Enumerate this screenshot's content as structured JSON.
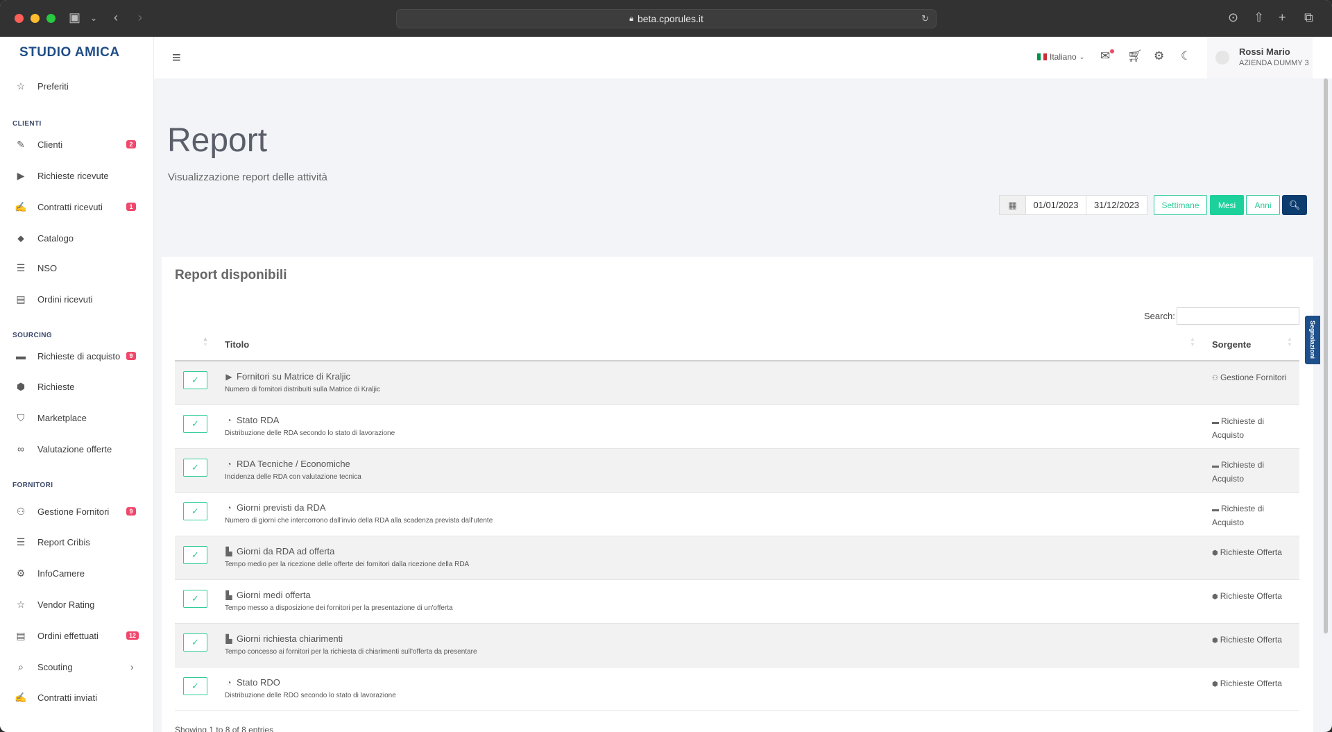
{
  "browser": {
    "url": "beta.cporules.it"
  },
  "sidebar": {
    "brand": "STUDIO AMICA",
    "items": [
      {
        "label": "Preferiti",
        "icon": "star-icon"
      },
      {
        "section": "CLIENTI"
      },
      {
        "label": "Clienti",
        "icon": "handshake-icon",
        "badge": "2"
      },
      {
        "label": "Richieste ricevute",
        "icon": "play-circle-icon"
      },
      {
        "label": "Contratti ricevuti",
        "icon": "contract-icon",
        "badge": "1"
      },
      {
        "label": "Catalogo",
        "icon": "tags-icon"
      },
      {
        "label": "NSO",
        "icon": "list-icon"
      },
      {
        "label": "Ordini ricevuti",
        "icon": "receipt-icon"
      },
      {
        "section": "SOURCING"
      },
      {
        "label": "Richieste di acquisto",
        "icon": "card-icon",
        "badge": "9"
      },
      {
        "label": "Richieste",
        "icon": "cube-icon"
      },
      {
        "label": "Marketplace",
        "icon": "shopping-bag-icon"
      },
      {
        "label": "Valutazione offerte",
        "icon": "glasses-icon"
      },
      {
        "section": "FORNITORI"
      },
      {
        "label": "Gestione Fornitori",
        "icon": "users-icon",
        "badge": "9"
      },
      {
        "label": "Report Cribis",
        "icon": "cribis-logo-icon"
      },
      {
        "label": "InfoCamere",
        "icon": "infocamere-icon"
      },
      {
        "label": "Vendor Rating",
        "icon": "star-icon"
      },
      {
        "label": "Ordini effettuati",
        "icon": "receipt-icon",
        "badge": "12"
      },
      {
        "label": "Scouting",
        "icon": "search-icon",
        "chevron": true
      },
      {
        "label": "Contratti inviati",
        "icon": "contract-icon"
      }
    ]
  },
  "topbar": {
    "language": "Italiano",
    "user_name": "Rossi Mario",
    "user_company": "AZIENDA DUMMY 3"
  },
  "header": {
    "title": "Report",
    "subtitle": "Visualizzazione report delle attività"
  },
  "filters": {
    "date_from": "01/01/2023",
    "date_to": "31/12/2023",
    "period_buttons": [
      "Settimane",
      "Mesi",
      "Anni"
    ],
    "active_period": "Mesi"
  },
  "card": {
    "title": "Report disponibili",
    "search_label": "Search:",
    "search_value": "",
    "columns": [
      "Titolo",
      "Sorgente"
    ],
    "rows": [
      {
        "icon": "play-circle-icon",
        "title": "Fornitori su Matrice di Kraljic",
        "desc": "Numero di fornitori distribuiti sulla Matrice di Kraljic",
        "source_icon": "users-icon",
        "source": "Gestione Fornitori"
      },
      {
        "icon": "pie-chart-icon",
        "title": "Stato RDA",
        "desc": "Distribuzione delle RDA secondo lo stato di lavorazione",
        "source_icon": "card-icon",
        "source": "Richieste di Acquisto"
      },
      {
        "icon": "pie-chart-icon",
        "title": "RDA Tecniche / Economiche",
        "desc": "Incidenza delle RDA con valutazione tecnica",
        "source_icon": "card-icon",
        "source": "Richieste di Acquisto"
      },
      {
        "icon": "pie-chart-icon",
        "title": "Giorni previsti da RDA",
        "desc": "Numero di giorni che intercorrono dall'invio della RDA alla scadenza prevista dall'utente",
        "source_icon": "card-icon",
        "source": "Richieste di Acquisto"
      },
      {
        "icon": "bar-chart-icon",
        "title": "Giorni da RDA ad offerta",
        "desc": "Tempo medio per la ricezione delle offerte dei fornitori dalla ricezione della RDA",
        "source_icon": "cube-icon",
        "source": "Richieste Offerta"
      },
      {
        "icon": "bar-chart-icon",
        "title": "Giorni medi offerta",
        "desc": "Tempo messo a disposizione dei fornitori per la presentazione di un'offerta",
        "source_icon": "cube-icon",
        "source": "Richieste Offerta"
      },
      {
        "icon": "bar-chart-icon",
        "title": "Giorni richiesta chiarimenti",
        "desc": "Tempo concesso ai fornitori per la richiesta di chiarimenti sull'offerta da presentare",
        "source_icon": "cube-icon",
        "source": "Richieste Offerta"
      },
      {
        "icon": "pie-chart-icon",
        "title": "Stato RDO",
        "desc": "Distribuzione delle RDO secondo lo stato di lavorazione",
        "source_icon": "cube-icon",
        "source": "Richieste Offerta"
      }
    ],
    "footer": "Showing 1 to 8 of 8 entries"
  },
  "side_tab": "Segnalazioni",
  "colors": {
    "accent_green": "#1dd19c",
    "navy": "#0d3c6e",
    "badge_red": "#f0476b",
    "brand_blue": "#1f4d87"
  }
}
